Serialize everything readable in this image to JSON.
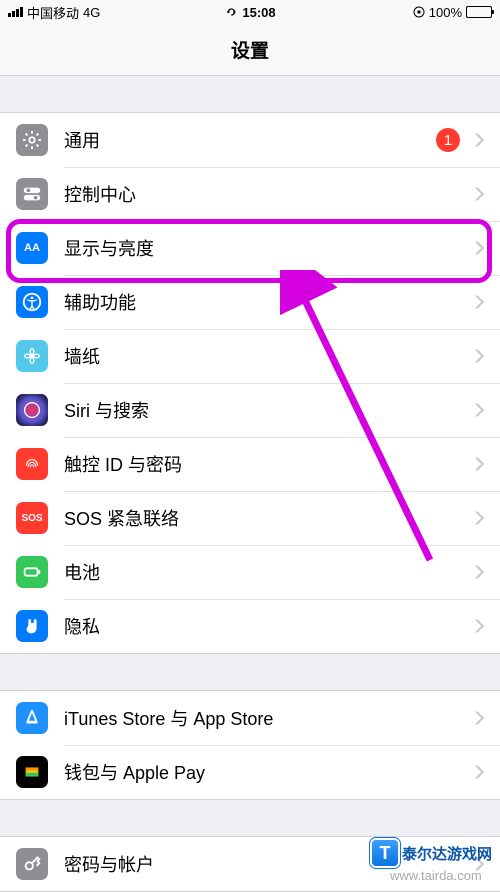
{
  "status": {
    "carrier": "中国移动",
    "network": "4G",
    "time": "15:08",
    "battery_pct": "100%"
  },
  "nav": {
    "title": "设置"
  },
  "groups": [
    {
      "rows": [
        {
          "key": "general",
          "label": "通用",
          "badge": "1",
          "icon_bg": "#8e8e93"
        },
        {
          "key": "control-center",
          "label": "控制中心",
          "icon_bg": "#8e8e93"
        },
        {
          "key": "display",
          "label": "显示与亮度",
          "icon_bg": "#007aff",
          "highlight": true
        },
        {
          "key": "accessibility",
          "label": "辅助功能",
          "icon_bg": "#007aff"
        },
        {
          "key": "wallpaper",
          "label": "墙纸",
          "icon_bg": "#54c7ec"
        },
        {
          "key": "siri",
          "label": "Siri 与搜索",
          "icon_bg": "#1c1c1e"
        },
        {
          "key": "touch-id",
          "label": "触控 ID 与密码",
          "icon_bg": "#ff3b30"
        },
        {
          "key": "sos",
          "label": "SOS 紧急联络",
          "icon_bg": "#ff3b30",
          "icon_text": "SOS"
        },
        {
          "key": "battery",
          "label": "电池",
          "icon_bg": "#34c759"
        },
        {
          "key": "privacy",
          "label": "隐私",
          "icon_bg": "#007aff"
        }
      ]
    },
    {
      "rows": [
        {
          "key": "itunes",
          "label": "iTunes Store 与 App Store",
          "icon_bg": "#1e90ff"
        },
        {
          "key": "wallet",
          "label": "钱包与 Apple Pay",
          "icon_bg": "#000"
        }
      ]
    },
    {
      "rows": [
        {
          "key": "accounts",
          "label": "密码与帐户",
          "icon_bg": "#8e8e93"
        }
      ]
    }
  ],
  "annotation": {
    "arrow_color": "#d400e0",
    "highlight_color": "#d400e0"
  },
  "watermark": {
    "line1": "泰尔达游戏网",
    "line2": "www.tairda.com",
    "logo_letter": "T"
  }
}
